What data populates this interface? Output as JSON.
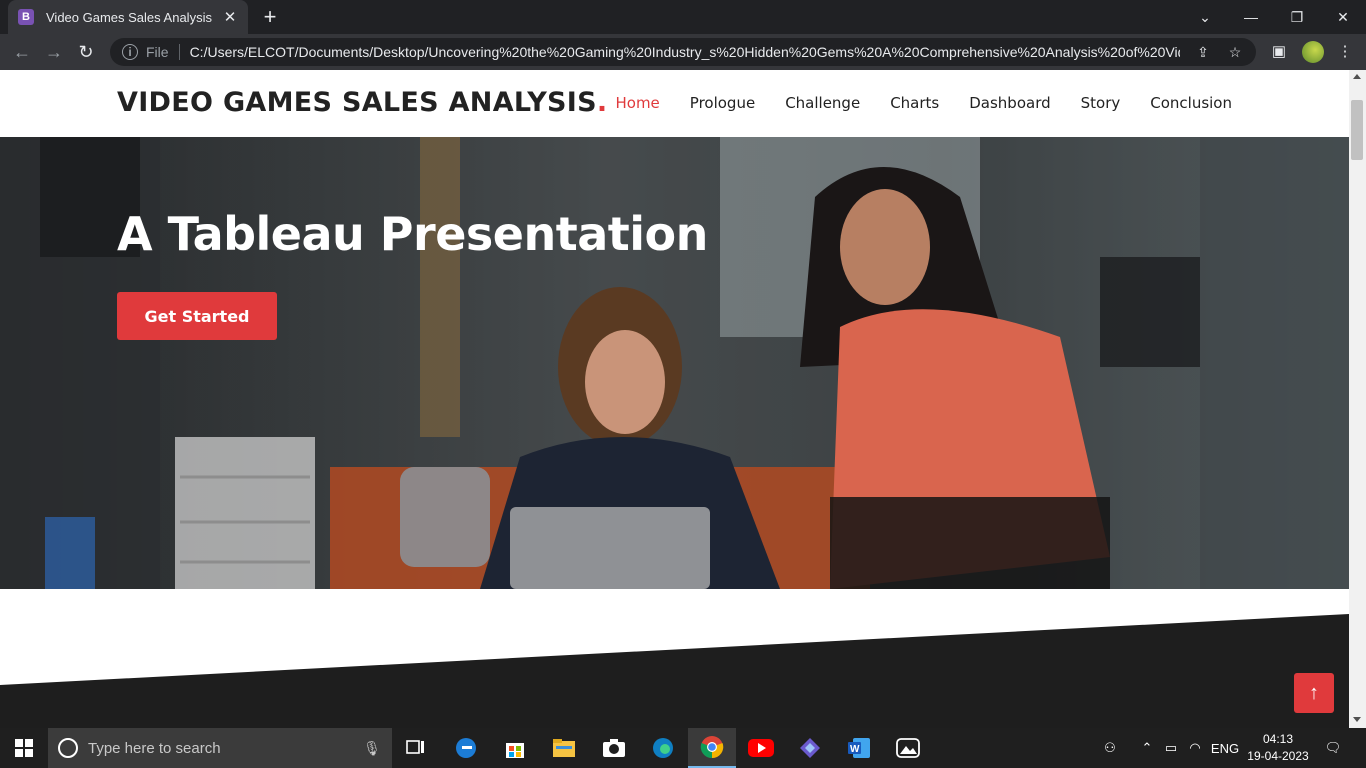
{
  "browser": {
    "tab_favicon": "B",
    "tab_title": "Video Games Sales Analysis",
    "tab_close": "✕",
    "new_tab": "+",
    "file_label": "File",
    "url": "C:/Users/ELCOT/Documents/Desktop/Uncovering%20the%20Gaming%20Industry_s%20Hidden%20Gems%20A%20Comprehensive%20Analysis%20of%20Video%..."
  },
  "site": {
    "logo_text": "VIDEO GAMES SALES ANALYSIS",
    "logo_dot": ".",
    "nav": [
      {
        "label": "Home",
        "active": true
      },
      {
        "label": "Prologue"
      },
      {
        "label": "Challenge"
      },
      {
        "label": "Charts"
      },
      {
        "label": "Dashboard"
      },
      {
        "label": "Story"
      },
      {
        "label": "Conclusion"
      }
    ],
    "hero_title": "A Tableau Presentation",
    "hero_button": "Get Started",
    "back_to_top": "↑",
    "accent_color": "#e03a3c"
  },
  "taskbar": {
    "search_placeholder": "Type here to search",
    "language": "ENG",
    "time": "04:13",
    "date": "19-04-2023"
  }
}
